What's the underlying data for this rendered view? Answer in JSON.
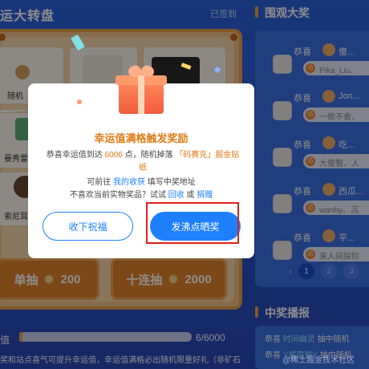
{
  "left": {
    "title": "运大转盘",
    "signed_status": "已签到",
    "prizes": [
      {
        "label": ""
      },
      {
        "label": ""
      },
      {
        "label": ""
      },
      {
        "label": "随机"
      },
      {
        "label": "曼秀雷"
      },
      {
        "label": "索尼耳"
      }
    ],
    "single_draw": {
      "label": "单抽",
      "cost": "200"
    },
    "ten_draw": {
      "label": "十连抽",
      "cost": "2000"
    },
    "luck": {
      "label": "值",
      "count": "6/6000",
      "progress": 0.001
    },
    "note": "奖和站点喜气可提升幸运值，幸运值满格必出随机限量好礼（非矿石"
  },
  "right": {
    "watchers_title": "围观大奖",
    "winners": [
      {
        "prefix": "恭喜",
        "user": "傻...",
        "item": "Pika_Liu、"
      },
      {
        "prefix": "恭喜",
        "user": "Jon...",
        "item": "一依不舍、"
      },
      {
        "prefix": "恭喜",
        "user": "吃...",
        "item": "大傻智、人"
      },
      {
        "prefix": "恭喜",
        "user": "西瓜...",
        "item": "wanhy、沉"
      },
      {
        "prefix": "恭喜",
        "user": "平...",
        "item": "来人间探险"
      }
    ],
    "pager": {
      "prev": "‹",
      "pages": [
        "1",
        "2",
        "3"
      ],
      "active": "1",
      "next": "›"
    },
    "broadcast_title": "中奖播报",
    "broadcast": [
      {
        "prefix": "恭喜",
        "user": "时间幽灵",
        "text": "抽中随机"
      },
      {
        "prefix": "恭喜",
        "user": "Y酱菜猫Y",
        "text": "抽中随机"
      }
    ]
  },
  "modal": {
    "title": "幸运值满格触发奖励",
    "body_prefix": "恭喜幸运值到达",
    "body_value": "6006",
    "body_mid": "点，随机掉落",
    "body_item": "「码赛克」掘金贴纸",
    "line2_prefix": "可前往",
    "line2_link": "我的收获",
    "line2_suffix": "填写中奖地址",
    "line3_prefix": "不喜欢当前实物奖品？试试",
    "line3_link1": "回收",
    "line3_or": "或",
    "line3_link2": "捐赠",
    "decline_label": "收下祝福",
    "share_label": "发沸点晒奖"
  },
  "watermark": "@稀土掘金技术社区",
  "colors": {
    "accent": "#1e80ff",
    "highlight": "#e07a14",
    "focus": "#e0201b",
    "background": "#2f5cd6"
  }
}
